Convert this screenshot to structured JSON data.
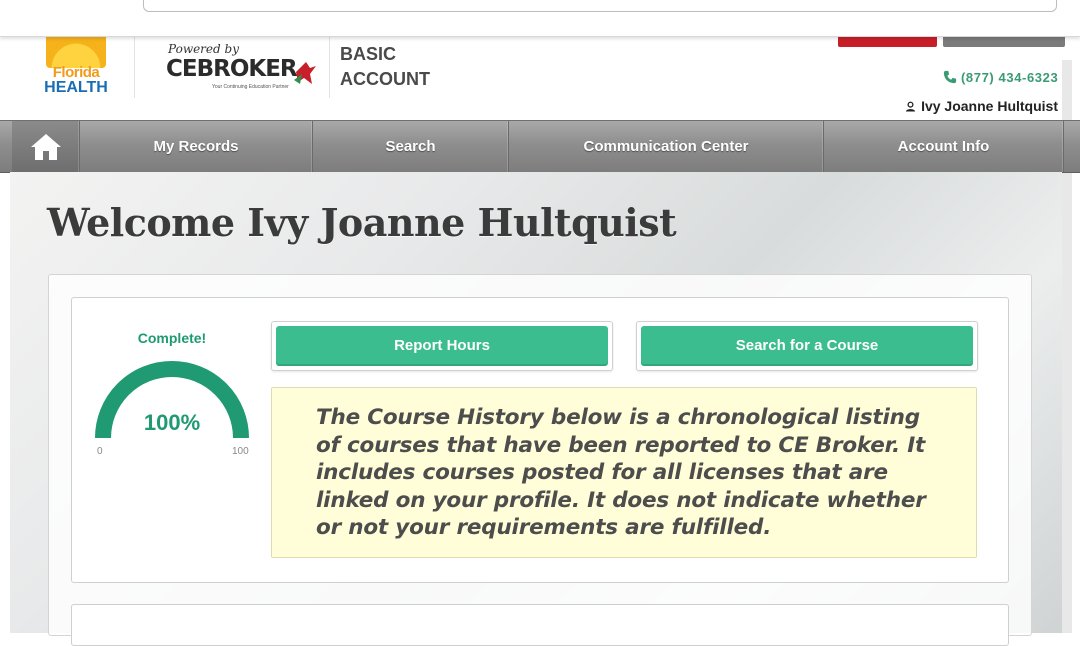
{
  "header": {
    "florida_logo": {
      "line1": "Florida",
      "line2": "HEALTH"
    },
    "powered_by": "Powered by",
    "ce_broker": "CEBROKER",
    "ce_broker_tagline": "Your Continuing Education Partner",
    "account_line1": "BASIC",
    "account_line2": "ACCOUNT",
    "phone": "(877) 434-6323",
    "user_name": "Ivy Joanne Hultquist"
  },
  "nav": {
    "items": [
      {
        "label": "My Records"
      },
      {
        "label": "Search"
      },
      {
        "label": "Communication Center"
      },
      {
        "label": "Account Info"
      }
    ]
  },
  "main": {
    "welcome": "Welcome Ivy Joanne Hultquist",
    "progress": {
      "status": "Complete!",
      "value_label": "100%",
      "value": 100,
      "min_label": "0",
      "max_label": "100"
    },
    "report_hours_label": "Report Hours",
    "search_course_label": "Search for a Course",
    "notice": "The Course History below is a chronological listing of courses that have been reported to CE Broker. It includes courses posted for all licenses that are linked on your profile. It does not indicate whether or not your requirements are fulfilled."
  },
  "colors": {
    "accent_green": "#3bbd90",
    "gauge_green": "#1f9a72",
    "notice_bg": "#fffed9",
    "nav_grey": "#8e8e8e",
    "brand_red": "#c81e28"
  }
}
